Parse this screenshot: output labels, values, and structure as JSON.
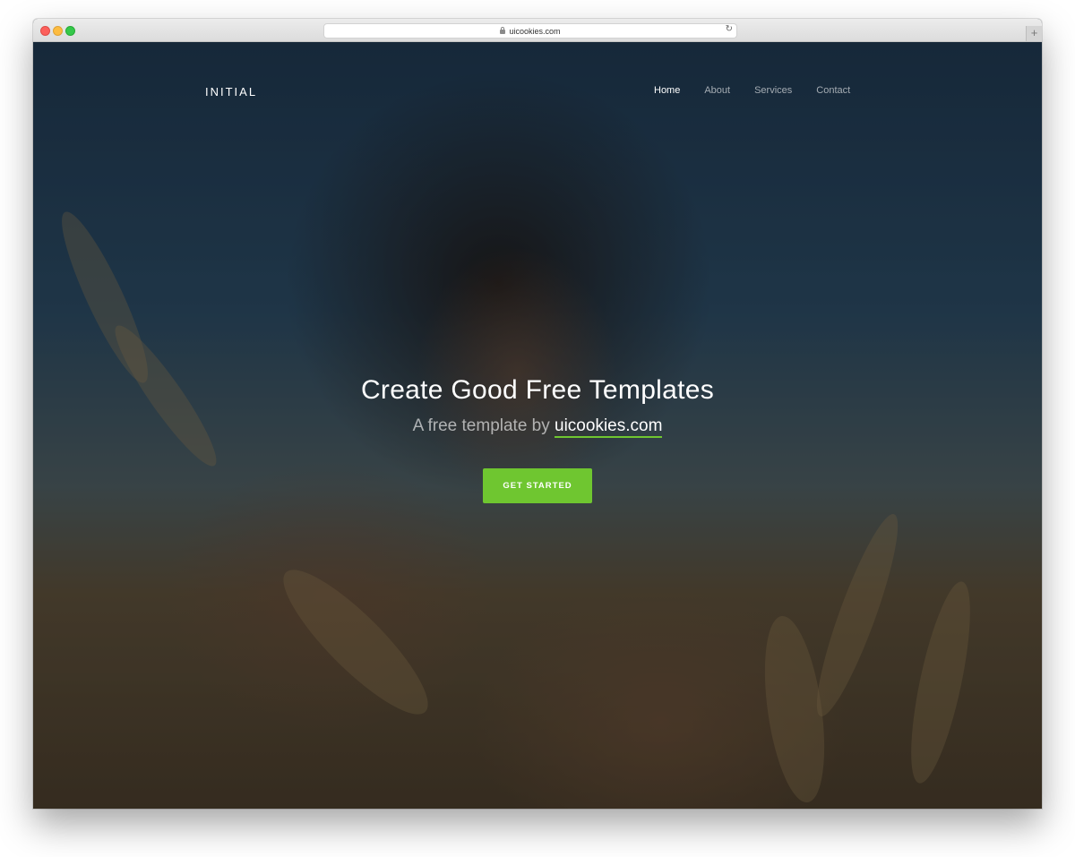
{
  "browser": {
    "url": "uicookies.com"
  },
  "site": {
    "brand": "INITIAL",
    "nav": [
      {
        "label": "Home"
      },
      {
        "label": "About"
      },
      {
        "label": "Services"
      },
      {
        "label": "Contact"
      }
    ]
  },
  "hero": {
    "title": "Create Good Free Templates",
    "subtitle_prefix": "A free template by ",
    "subtitle_link": "uicookies.com",
    "cta_label": "GET STARTED"
  },
  "colors": {
    "accent": "#6fc630"
  }
}
